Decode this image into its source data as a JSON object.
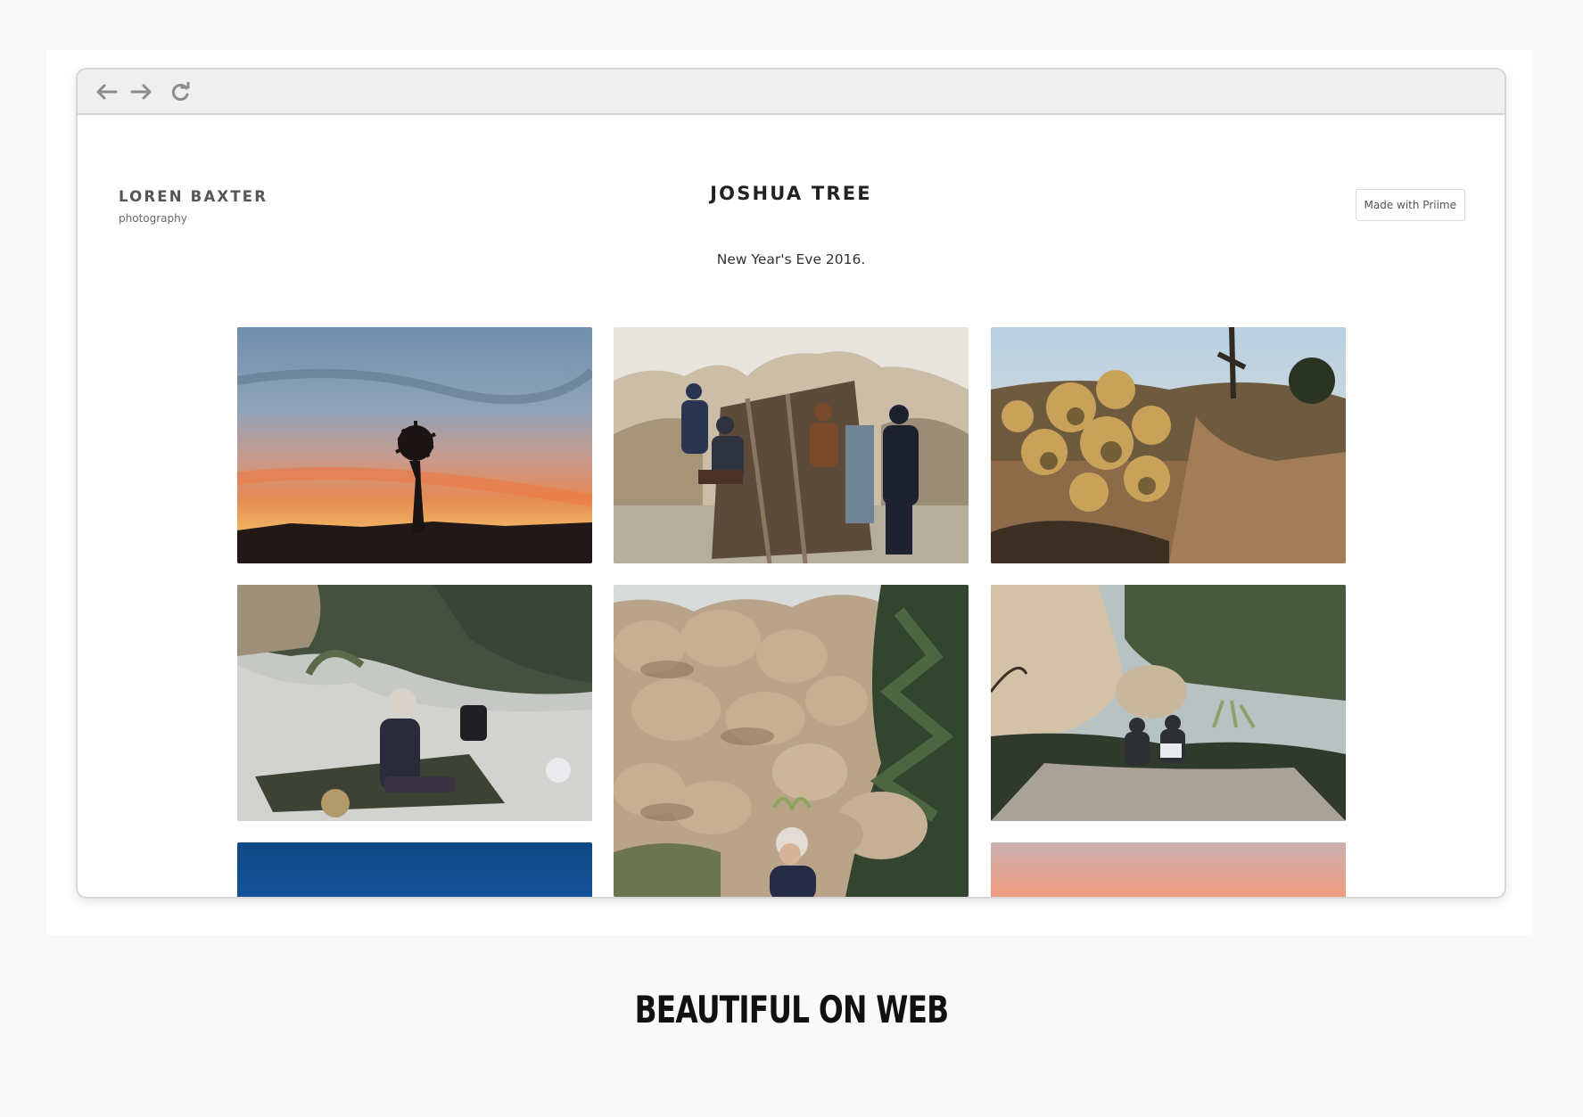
{
  "site": {
    "brand_name": "LOREN BAXTER",
    "brand_sub": "photography",
    "title": "JOSHUA TREE",
    "subtitle": "New Year's Eve 2016.",
    "made_with": "Made with Priime"
  },
  "browser": {
    "back_icon": "arrow-left-icon",
    "forward_icon": "arrow-right-icon",
    "reload_icon": "reload-icon"
  },
  "gallery": {
    "photos": [
      {
        "subject": "desert sunset with joshua tree silhouette"
      },
      {
        "subject": "four people posing on an old wooden structure among boulders"
      },
      {
        "subject": "backlit cholla cactus in desert"
      },
      {
        "subject": "person in beanie sitting on blanket among rocks"
      },
      {
        "subject": "boulder pile with pine tree and woman in beanie"
      },
      {
        "subject": "large boulders with two people sitting in the brush"
      },
      {
        "subject": "deep blue sky"
      },
      {
        "subject": "pink sunset sky"
      }
    ]
  },
  "caption": "BEAUTIFUL ON WEB",
  "colors": {
    "background": "#f9f9f9",
    "chrome": "#efefef",
    "text_dark": "#222222"
  }
}
